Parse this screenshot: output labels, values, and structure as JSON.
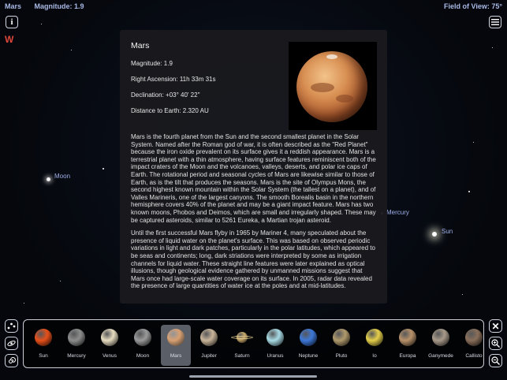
{
  "status": {
    "object_name": "Mars",
    "magnitude": "Magnitude: 1.9",
    "field_of_view": "Field of View: 75°"
  },
  "compass": {
    "direction": "W"
  },
  "icons": {
    "info": "info-icon",
    "list": "list-icon",
    "close": "close-icon",
    "zoom_in": "zoom-in-icon",
    "zoom_out": "zoom-out-icon",
    "constellations": "constellation-icon",
    "galaxy": "galaxy-icon",
    "spiral": "spiral-icon"
  },
  "sky_labels": {
    "moon": "Moon",
    "mercury": "Mercury",
    "sun": "Sun"
  },
  "info_panel": {
    "title": "Mars",
    "magnitude": "Magnitude: 1.9",
    "right_ascension": "Right Ascension: 11h 33m 31s",
    "declination": "Declination: +03° 40' 22\"",
    "distance": "Distance to Earth: 2.320 AU",
    "paragraphs": [
      "Mars is the fourth planet from the Sun and the second smallest planet in the Solar System. Named after the Roman god of war, it is often described as the \"Red Planet\" because the iron oxide prevalent on its surface gives it a reddish appearance. Mars is a terrestrial planet with a thin atmosphere, having surface features reminiscent both of the impact craters of the Moon and the volcanoes, valleys, deserts, and polar ice caps of Earth. The rotational period and seasonal cycles of Mars are likewise similar to those of Earth, as is the tilt that produces the seasons. Mars is the site of Olympus Mons, the second highest known mountain within the Solar System (the tallest on a planet), and of Valles Marineris, one of the largest canyons. The smooth Borealis basin in the northern hemisphere covers 40% of the planet and may be a giant impact feature. Mars has two known moons, Phobos and Deimos, which are small and irregularly shaped. These may be captured asteroids, similar to 5261 Eureka, a Martian trojan asteroid.",
      "Until the first successful Mars flyby in 1965 by Mariner 4, many speculated about the presence of liquid water on the planet's surface. This was based on observed periodic variations in light and dark patches, particularly in the polar latitudes, which appeared to be seas and continents; long, dark striations were interpreted by some as irrigation channels for liquid water. These straight line features were later explained as optical illusions, though geological evidence gathered by unmanned missions suggest that Mars once had large-scale water coverage on its surface. In 2005, radar data revealed the presence of large quantities of water ice at the poles and at mid-latitudes."
    ]
  },
  "tray": {
    "selected": "Mars",
    "items": [
      {
        "label": "Sun",
        "color": "#e8501a"
      },
      {
        "label": "Mercury",
        "color": "#8d8d8d"
      },
      {
        "label": "Venus",
        "color": "#e6dcc0"
      },
      {
        "label": "Moon",
        "color": "#9a9a9a"
      },
      {
        "label": "Mars",
        "color": "#d9a070"
      },
      {
        "label": "Jupiter",
        "color": "#c9b59a"
      },
      {
        "label": "Saturn",
        "color": "#c8a86a"
      },
      {
        "label": "Uranus",
        "color": "#a8dbe6"
      },
      {
        "label": "Neptune",
        "color": "#3d78d8"
      },
      {
        "label": "Pluto",
        "color": "#b09a6c"
      },
      {
        "label": "Io",
        "color": "#e5cf4a"
      },
      {
        "label": "Europa",
        "color": "#b7916a"
      },
      {
        "label": "Ganymede",
        "color": "#a89a8a"
      },
      {
        "label": "Callisto",
        "color": "#8a6f5a"
      }
    ]
  }
}
